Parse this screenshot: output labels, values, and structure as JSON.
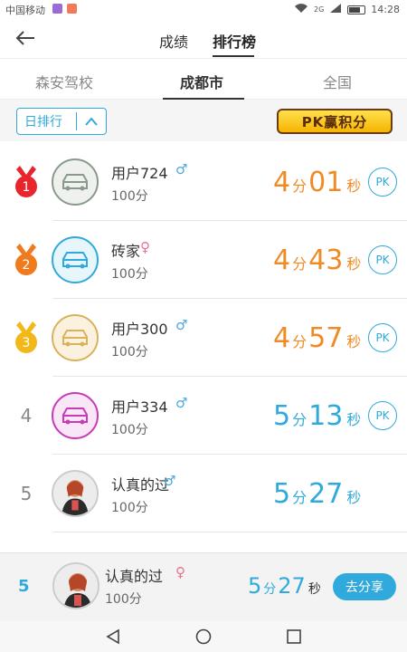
{
  "status_bar": {
    "carrier": "中国移动",
    "network": "2G",
    "time": "14:28"
  },
  "top_tabs": [
    {
      "label": "成绩"
    },
    {
      "label": "排行榜"
    }
  ],
  "filter_tabs": [
    {
      "label": "森安驾校"
    },
    {
      "label": "成都市"
    },
    {
      "label": "全国"
    }
  ],
  "period_select": {
    "label": "日排行"
  },
  "pk_banner": {
    "text": "PK赢积分"
  },
  "time_units": {
    "min": "分",
    "sec": "秒"
  },
  "pk_label": "PK",
  "rows": [
    {
      "rank": "1",
      "name": "用户724",
      "gender": "♂",
      "score": "100分",
      "min": "4",
      "sec": "01",
      "avatar": "car-avatar",
      "color": "#f08a24"
    },
    {
      "rank": "2",
      "name": "砖家",
      "gender": "♀",
      "score": "100分",
      "min": "4",
      "sec": "43",
      "avatar": "car-avatar",
      "color": "#f08a24"
    },
    {
      "rank": "3",
      "name": "用户300",
      "gender": "♂",
      "score": "100分",
      "min": "4",
      "sec": "57",
      "avatar": "car-avatar",
      "color": "#f08a24"
    },
    {
      "rank": "4",
      "name": "用户334",
      "gender": "♂",
      "score": "100分",
      "min": "5",
      "sec": "13",
      "avatar": "car-avatar",
      "color": "#30a9dc"
    },
    {
      "rank": "5",
      "name": "认真的过",
      "gender": "♂",
      "score": "100分",
      "min": "5",
      "sec": "27",
      "avatar": "photo-avatar",
      "color": "#30a9dc"
    }
  ],
  "my_rank": {
    "rank": "5",
    "name": "认真的过",
    "gender": "♀",
    "score": "100分",
    "min": "5",
    "sec": "27",
    "share_label": "去分享"
  },
  "colors": {
    "accent": "#30a9dc",
    "top3": "#f08a24",
    "male": "#4aa8e0",
    "female": "#e8728a"
  }
}
